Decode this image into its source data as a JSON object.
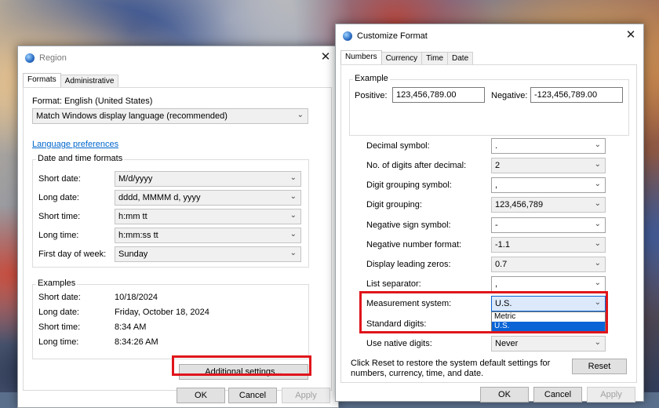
{
  "region": {
    "title": "Region",
    "tabs": [
      "Formats",
      "Administrative"
    ],
    "format_label": "Format: English (United States)",
    "format_value": "Match Windows display language (recommended)",
    "language_link": "Language preferences",
    "datetime_group": "Date and time formats",
    "rows": [
      {
        "label": "Short date:",
        "value": "M/d/yyyy"
      },
      {
        "label": "Long date:",
        "value": "dddd, MMMM d, yyyy"
      },
      {
        "label": "Short time:",
        "value": "h:mm tt"
      },
      {
        "label": "Long time:",
        "value": "h:mm:ss tt"
      },
      {
        "label": "First day of week:",
        "value": "Sunday"
      }
    ],
    "examples_group": "Examples",
    "examples": [
      {
        "label": "Short date:",
        "value": "10/18/2024"
      },
      {
        "label": "Long date:",
        "value": "Friday, October 18, 2024"
      },
      {
        "label": "Short time:",
        "value": "8:34 AM"
      },
      {
        "label": "Long time:",
        "value": "8:34:26 AM"
      }
    ],
    "additional_btn": "Additional settings...",
    "ok": "OK",
    "cancel": "Cancel",
    "apply": "Apply"
  },
  "customize": {
    "title": "Customize Format",
    "tabs": [
      "Numbers",
      "Currency",
      "Time",
      "Date"
    ],
    "example_group": "Example",
    "positive_label": "Positive:",
    "positive_value": "123,456,789.00",
    "negative_label": "Negative:",
    "negative_value": "-123,456,789.00",
    "rows": [
      {
        "label": "Decimal symbol:",
        "value": "."
      },
      {
        "label": "No. of digits after decimal:",
        "value": "2"
      },
      {
        "label": "Digit grouping symbol:",
        "value": ","
      },
      {
        "label": "Digit grouping:",
        "value": "123,456,789"
      },
      {
        "label": "Negative sign symbol:",
        "value": "-"
      },
      {
        "label": "Negative number format:",
        "value": "-1.1"
      },
      {
        "label": "Display leading zeros:",
        "value": "0.7"
      },
      {
        "label": "List separator:",
        "value": ","
      },
      {
        "label": "Measurement system:",
        "value": "U.S."
      },
      {
        "label": "Standard digits:",
        "value": ""
      },
      {
        "label": "Use native digits:",
        "value": "Never"
      }
    ],
    "measurement_options": [
      "Metric",
      "U.S."
    ],
    "reset_text_1": "Click Reset to restore the system default settings for",
    "reset_text_2": "numbers, currency, time, and date.",
    "reset_btn": "Reset",
    "ok": "OK",
    "cancel": "Cancel",
    "apply": "Apply"
  },
  "colors": {
    "highlight": "#e0151b",
    "selection": "#0a64d6",
    "link": "#0066cc"
  }
}
